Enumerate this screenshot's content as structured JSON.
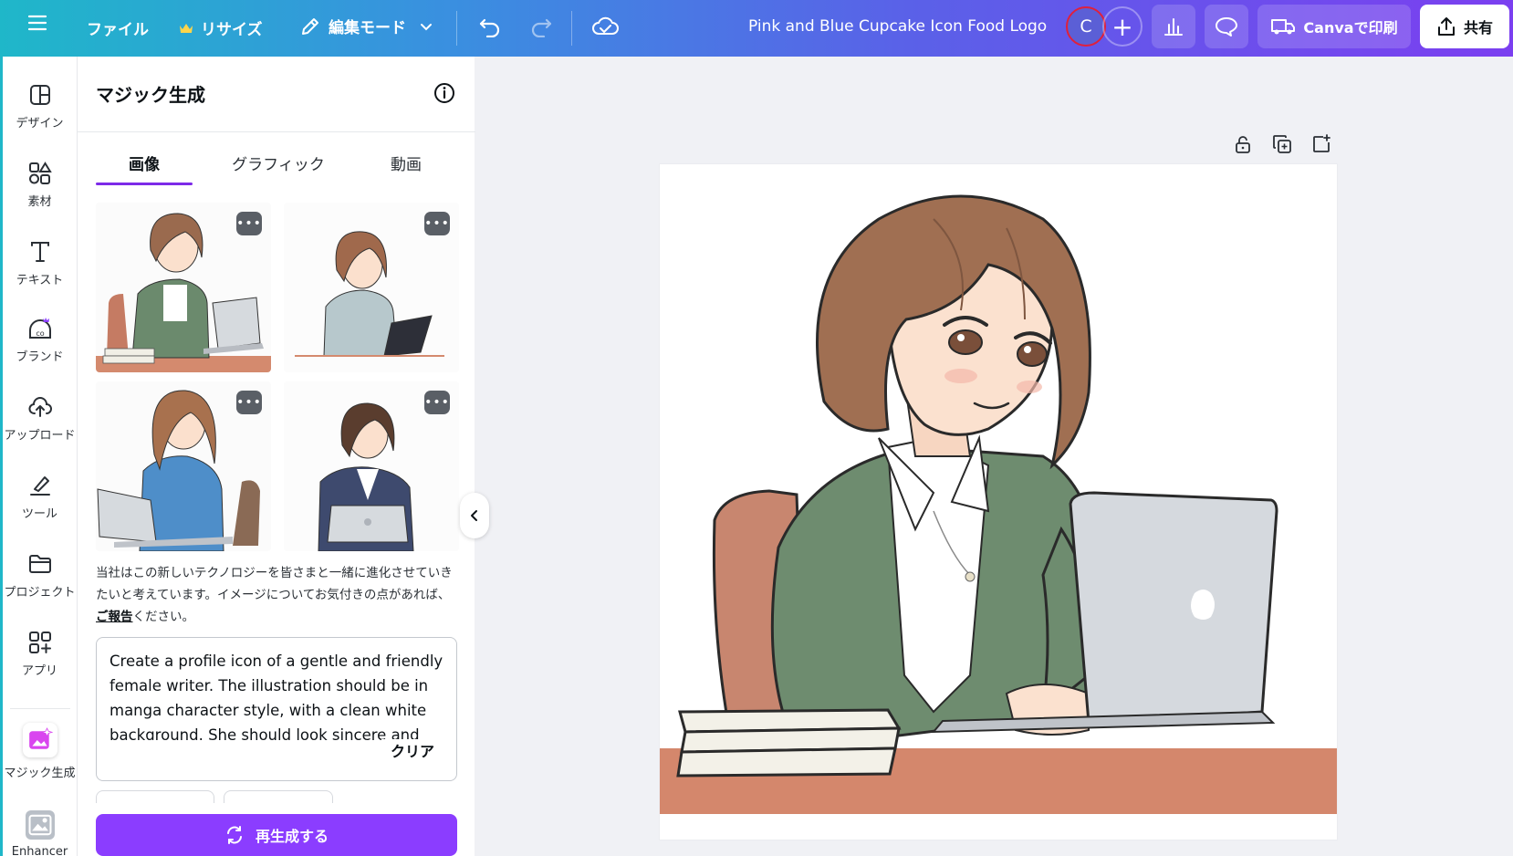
{
  "topbar": {
    "menu_icon": "hamburger-icon",
    "file_label": "ファイル",
    "resize_label": "リサイズ",
    "edit_mode_label": "編集モード",
    "doc_title": "Pink and Blue Cupcake Icon Food Logo",
    "avatar_initial": "C",
    "print_label": "Canvaで印刷",
    "share_label": "共有"
  },
  "rail": {
    "items": [
      {
        "label": "デザイン",
        "icon": "layout-icon"
      },
      {
        "label": "素材",
        "icon": "elements-icon"
      },
      {
        "label": "テキスト",
        "icon": "text-icon"
      },
      {
        "label": "ブランド",
        "icon": "brand-icon"
      },
      {
        "label": "アップロード",
        "icon": "upload-cloud-icon"
      },
      {
        "label": "ツール",
        "icon": "draw-tool-icon"
      },
      {
        "label": "プロジェクト",
        "icon": "folder-icon"
      },
      {
        "label": "アプリ",
        "icon": "apps-icon"
      },
      {
        "label": "マジック生成",
        "icon": "magic-media-icon"
      },
      {
        "label": "Enhancer",
        "icon": "enhancer-icon"
      }
    ]
  },
  "panel": {
    "title": "マジック生成",
    "tabs": [
      {
        "label": "画像",
        "active": true
      },
      {
        "label": "グラフィック",
        "active": false
      },
      {
        "label": "動画",
        "active": false
      }
    ],
    "more_label": "•••",
    "disclaimer_text": "当社はこの新しいテクノロジーを皆さまと一緒に進化させていきたいと考えています。イメージについてお気付きの点があれば、",
    "report_link": "ご報告",
    "disclaimer_tail": "ください。",
    "prompt_text": "Create a profile icon of a gentle and friendly female writer. The illustration should be in manga character style, with a clean white background. She should look sincere and",
    "clear_label": "クリア",
    "regenerate_label": "再生成する"
  },
  "colors": {
    "accent": "#8b3dff",
    "tab_underline": "#7d2ae8",
    "gradient_start": "#1fb7c9",
    "gradient_end": "#7b3ff0",
    "avatar_ring": "#e0203c"
  }
}
